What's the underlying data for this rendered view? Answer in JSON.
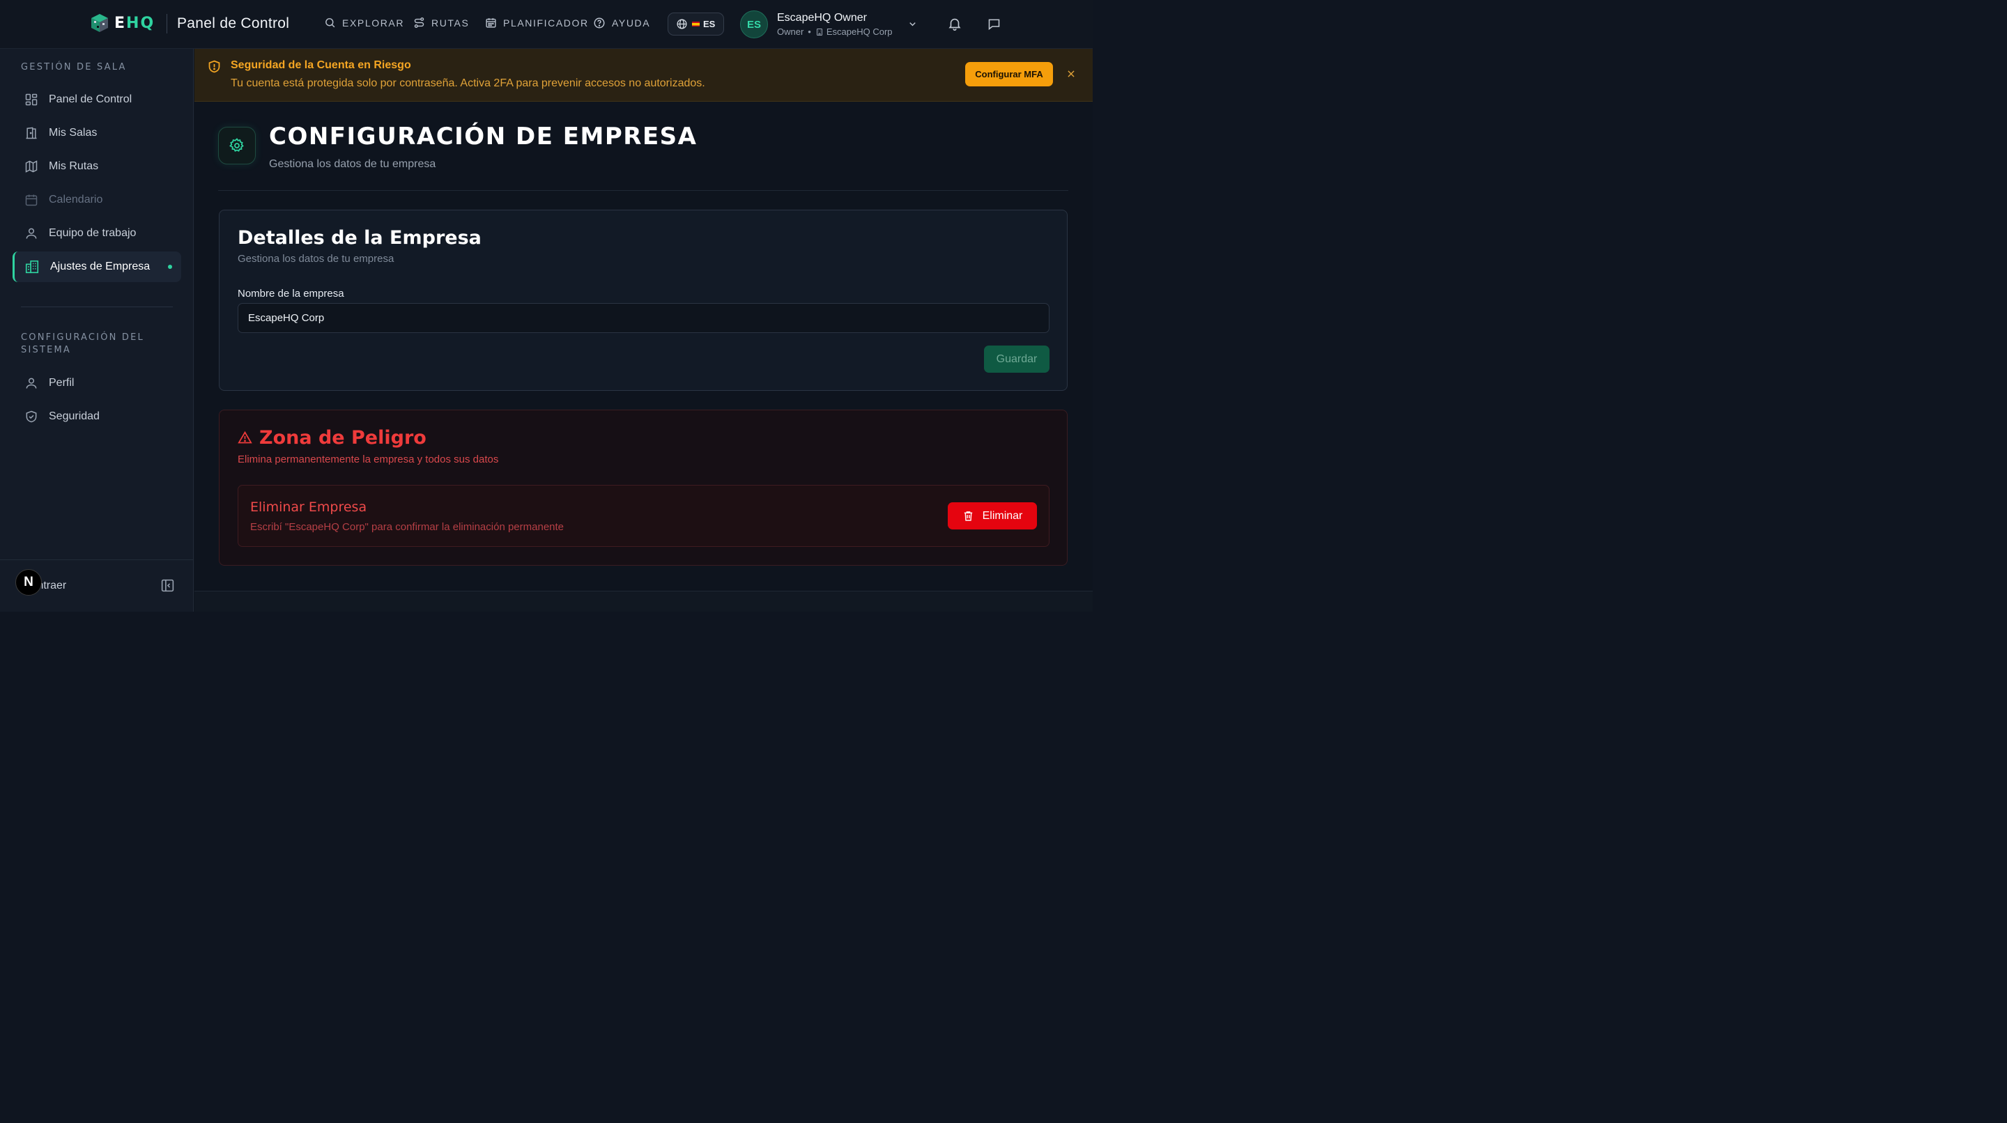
{
  "header": {
    "logo_e": "E",
    "logo_hq": "HQ",
    "title": "Panel de Control",
    "nav": [
      {
        "label": "EXPLORAR",
        "icon": "search-icon"
      },
      {
        "label": "RUTAS",
        "icon": "route-icon"
      },
      {
        "label": "PLANIFICADOR",
        "icon": "calendar-icon"
      },
      {
        "label": "AYUDA",
        "icon": "help-circle-icon"
      }
    ],
    "language": "ES",
    "user": {
      "initials": "ES",
      "name": "EscapeHQ Owner",
      "role": "Owner",
      "separator": "•",
      "company": "EscapeHQ Corp"
    }
  },
  "sidebar": {
    "section1_title": "Gestión de sala",
    "items": [
      {
        "label": "Panel de Control",
        "icon": "dashboard-grid-icon"
      },
      {
        "label": "Mis Salas",
        "icon": "door-icon"
      },
      {
        "label": "Mis Rutas",
        "icon": "map-icon"
      },
      {
        "label": "Calendario",
        "icon": "calendar-icon",
        "state": "disabled"
      },
      {
        "label": "Equipo de trabajo",
        "icon": "user-icon"
      },
      {
        "label": "Ajustes de Empresa",
        "icon": "building-icon",
        "state": "active"
      }
    ],
    "section2_title": "Configuración del sistema",
    "items2": [
      {
        "label": "Perfil",
        "icon": "user-icon"
      },
      {
        "label": "Seguridad",
        "icon": "shield-check-icon"
      }
    ],
    "footer_badge": "N",
    "footer_label": "Contraer"
  },
  "banner": {
    "title": "Seguridad de la Cuenta en Riesgo",
    "text": "Tu cuenta está protegida solo por contraseña. Activa 2FA para prevenir accesos no autorizados.",
    "button": "Configurar MFA"
  },
  "page": {
    "title": "CONFIGURACIÓN DE EMPRESA",
    "subtitle": "Gestiona los datos de tu empresa"
  },
  "company_card": {
    "title": "Detalles de la Empresa",
    "subtitle": "Gestiona los datos de tu empresa",
    "field_label": "Nombre de la empresa",
    "field_value": "EscapeHQ Corp",
    "save_label": "Guardar"
  },
  "danger_zone": {
    "title": "Zona de Peligro",
    "subtitle": "Elimina permanentemente la empresa y todos sus datos",
    "delete_title": "Eliminar Empresa",
    "delete_hint": "Escribí \"EscapeHQ Corp\" para confirmar la eliminación permanente",
    "delete_button": "Eliminar"
  },
  "colors": {
    "accent": "#2fd3a0",
    "warning": "#f59e0b",
    "danger": "#e5040f",
    "background": "#0f1520"
  }
}
